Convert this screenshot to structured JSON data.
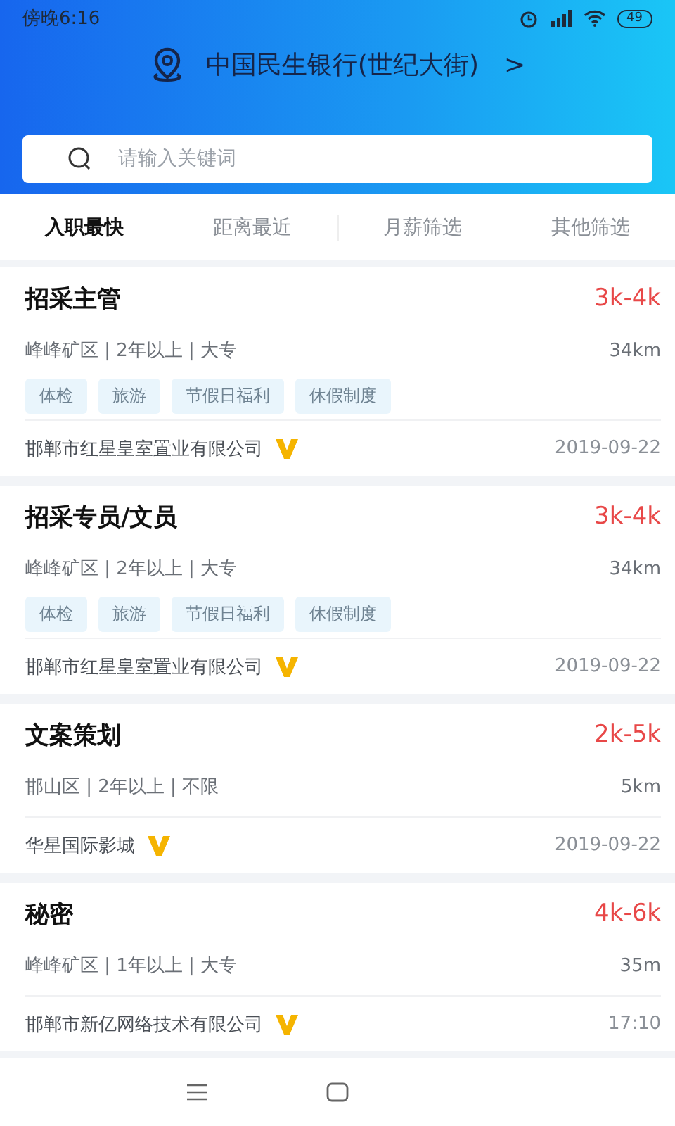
{
  "status_bar": {
    "time": "傍晚6:16",
    "battery": "49"
  },
  "location": {
    "name": "中国民生银行(世纪大街)",
    "arrow": ">"
  },
  "search": {
    "placeholder": "请输入关键词"
  },
  "tabs": [
    {
      "label": "入职最快",
      "selected": true
    },
    {
      "label": "距离最近",
      "selected": false
    },
    {
      "label": "月薪筛选",
      "selected": false
    },
    {
      "label": "其他筛选",
      "selected": false
    }
  ],
  "jobs": [
    {
      "title": "招采主管",
      "salary": "3k-4k",
      "meta": "峰峰矿区 | 2年以上 | 大专",
      "distance": "34km",
      "tags": [
        "体检",
        "旅游",
        "节假日福利",
        "休假制度"
      ],
      "company": "邯郸市红星皇室置业有限公司",
      "verified": true,
      "date": "2019-09-22"
    },
    {
      "title": "招采专员/文员",
      "salary": "3k-4k",
      "meta": "峰峰矿区 | 2年以上 | 大专",
      "distance": "34km",
      "tags": [
        "体检",
        "旅游",
        "节假日福利",
        "休假制度"
      ],
      "company": "邯郸市红星皇室置业有限公司",
      "verified": true,
      "date": "2019-09-22"
    },
    {
      "title": "文案策划",
      "salary": "2k-5k",
      "meta": "邯山区 | 2年以上 | 不限",
      "distance": "5km",
      "company": "华星国际影城",
      "verified": true,
      "date": "2019-09-22"
    },
    {
      "title": "秘密",
      "salary": "4k-6k",
      "meta": "峰峰矿区 | 1年以上 | 大专",
      "distance": "35m",
      "company": "邯郸市新亿网络技术有限公司",
      "verified": true,
      "date": "17:10"
    }
  ]
}
